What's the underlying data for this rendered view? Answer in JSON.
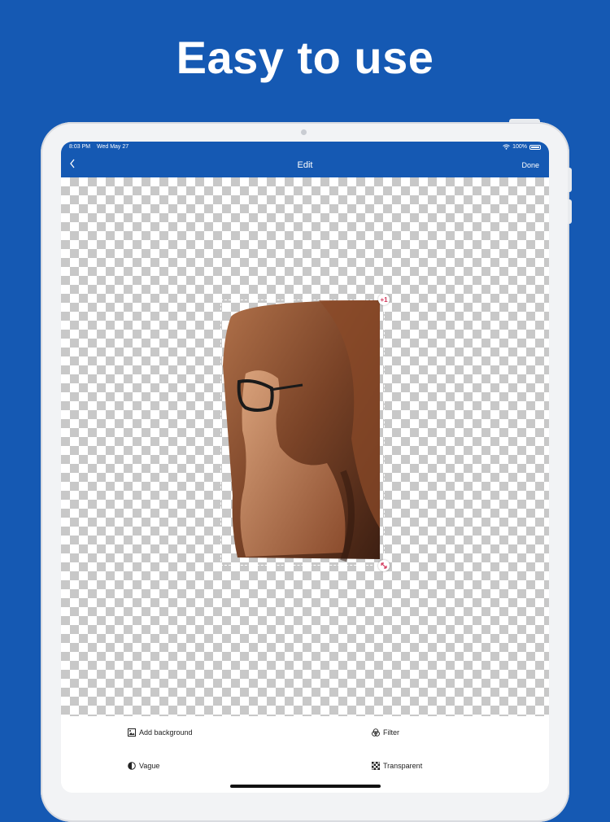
{
  "headline": "Easy to use",
  "status_bar": {
    "time": "8:03 PM",
    "date": "Wed May 27",
    "battery": "100%"
  },
  "navbar": {
    "back_icon": "chevron-left-icon",
    "title": "Edit",
    "done_label": "Done"
  },
  "sticker": {
    "copy_handle": "+1",
    "resize_icon": "resize-arrow-icon"
  },
  "toolbar": {
    "add_background": "Add background",
    "filter": "Filter",
    "vague": "Vague",
    "transparent": "Transparent"
  },
  "colors": {
    "brand": "#1559b3",
    "handle_accent": "#d2365a"
  }
}
